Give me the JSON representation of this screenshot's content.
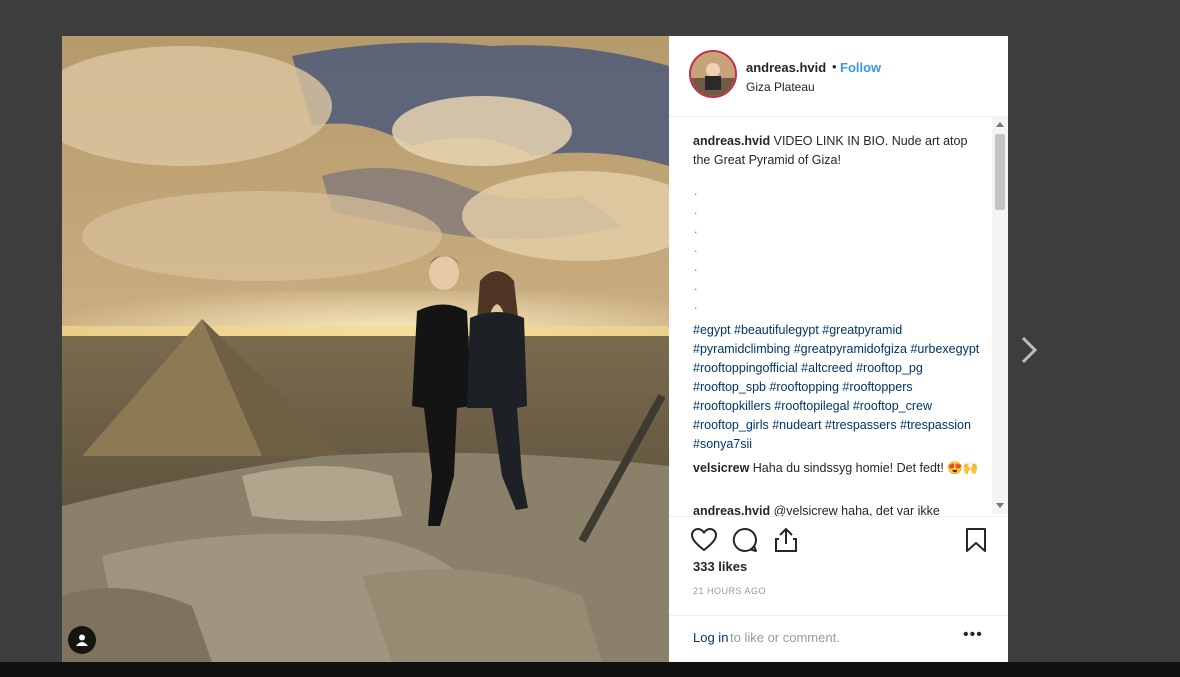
{
  "post": {
    "username": "andreas.hvid",
    "dot": "•",
    "follow_label": "Follow",
    "location": "Giza Plateau"
  },
  "caption": {
    "author": "andreas.hvid",
    "text": "VIDEO LINK IN BIO. Nude art atop the Great Pyramid of Giza!",
    "dots": [
      ".",
      ".",
      ".",
      ".",
      ".",
      ".",
      "."
    ],
    "hashtags": "#egypt #beautifulegypt #greatpyramid #pyramidclimbing #greatpyramidofgiza #urbexegypt #rooftoppingofficial #altcreed #rooftop_pg #rooftop_spb #rooftopping #rooftoppers #rooftopkillers #rooftopilegal #rooftop_crew #rooftop_girls #nudeart #trespassers #trespassion #sonya7sii"
  },
  "comments": [
    {
      "author": "velsicrew",
      "text": "Haha du sindssyg homie! Det fedt! 😍🙌"
    },
    {
      "author": "andreas.hvid",
      "text": "@velsicrew haha, det var ikke"
    }
  ],
  "engagement": {
    "likes": "333 likes",
    "time": "21 HOURS AGO"
  },
  "footer": {
    "login_label": "Log in",
    "login_rest": "to like or comment.",
    "more_label": "•••"
  },
  "icons": {
    "heart": "heart-icon",
    "comment": "comment-icon",
    "share": "share-icon",
    "bookmark": "bookmark-icon",
    "user_tag": "user-tag-icon",
    "next": "chevron-right-icon"
  },
  "colors": {
    "link_blue": "#3897f0",
    "hashtag": "#003569",
    "backdrop": "#3d3d3d"
  }
}
